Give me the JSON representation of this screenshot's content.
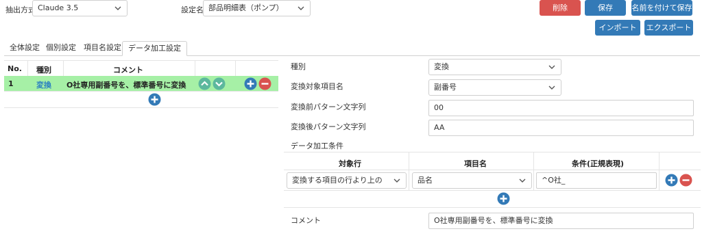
{
  "header": {
    "extract_label": "抽出方式",
    "extract_value": "Claude 3.5",
    "setting_label": "設定名",
    "setting_value": "部品明細表（ポンプ）",
    "delete_label": "削除",
    "save_label": "保存",
    "save_as_label": "名前を付けて保存",
    "import_label": "インポート",
    "export_label": "エクスポート"
  },
  "tabs": [
    "全体設定",
    "個別設定",
    "項目名設定",
    "データ加工設定"
  ],
  "active_tab": 3,
  "left_table": {
    "headers": {
      "no": "No.",
      "type": "種別",
      "comment": "コメント"
    },
    "rows": [
      {
        "no": "1",
        "type": "変換",
        "comment": "O社専用副番号を、標準番号に変換"
      }
    ]
  },
  "form": {
    "type_label": "種別",
    "type_value": "変換",
    "target_label": "変換対象項目名",
    "target_value": "副番号",
    "before_label": "変換前パターン文字列",
    "before_value": "00",
    "after_label": "変換後パターン文字列",
    "after_value": "AA",
    "condition_label": "データ加工条件",
    "comment_label": "コメント",
    "comment_value": "O社専用副番号を、標準番号に変換"
  },
  "condition_table": {
    "headers": {
      "row": "対象行",
      "item": "項目名",
      "cond": "条件(正規表現)"
    },
    "rows": [
      {
        "row": "変換する項目の行より上の",
        "item": "品名",
        "cond": "^O社_"
      }
    ]
  },
  "colors": {
    "selected_row": "#a6f0a6",
    "accent_blue": "#337ab7",
    "danger_red": "#d9534f",
    "arrow_teal": "#5cb89d",
    "type_link": "#2a7fc1"
  },
  "icons": {
    "chevron": "chevron-down-icon",
    "move_up": "arrow-up-circle-icon",
    "move_down": "arrow-down-circle-icon",
    "add": "plus-circle-icon",
    "remove": "minus-circle-icon"
  }
}
